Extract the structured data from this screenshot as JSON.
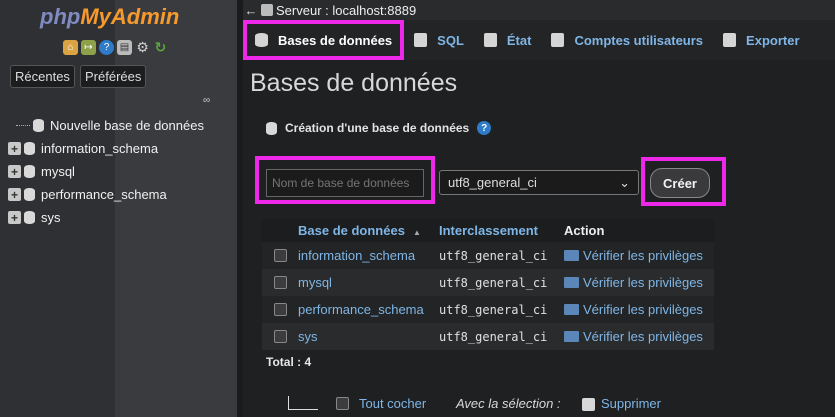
{
  "navigation": {
    "logo_php": "php",
    "logo_myadmin": "MyAdmin",
    "tabs": [
      "Récentes",
      "Préférées"
    ],
    "new_database": "Nouvelle base de données",
    "databases": [
      "information_schema",
      "mysql",
      "performance_schema",
      "sys"
    ]
  },
  "topbar": {
    "server": "Serveur : localhost:8889"
  },
  "tabs": [
    {
      "label": "Bases de données",
      "icon": "database-icon"
    },
    {
      "label": "SQL",
      "icon": "sql-icon"
    },
    {
      "label": "État",
      "icon": "status-icon"
    },
    {
      "label": "Comptes utilisateurs",
      "icon": "users-icon"
    },
    {
      "label": "Exporter",
      "icon": "export-icon"
    }
  ],
  "main": {
    "title": "Bases de données",
    "create_heading": "Création d'une base de données",
    "dbname_placeholder": "Nom de base de données",
    "collation_selected": "utf8_general_ci",
    "create_button": "Créer",
    "columns": [
      "Base de données",
      "Interclassement",
      "Action"
    ],
    "rows": [
      {
        "name": "information_schema",
        "collation": "utf8_general_ci",
        "action": "Vérifier les privilèges"
      },
      {
        "name": "mysql",
        "collation": "utf8_general_ci",
        "action": "Vérifier les privilèges"
      },
      {
        "name": "performance_schema",
        "collation": "utf8_general_ci",
        "action": "Vérifier les privilèges"
      },
      {
        "name": "sys",
        "collation": "utf8_general_ci",
        "action": "Vérifier les privilèges"
      }
    ],
    "total": "Total : 4",
    "check_all": "Tout cocher",
    "with_selected": "Avec la sélection :",
    "delete": "Supprimer"
  },
  "colors": {
    "highlight": "#ee28e8",
    "link": "#7fb6e6",
    "logo_php": "#7f8bc2",
    "logo_myadmin": "#f79a2e"
  }
}
